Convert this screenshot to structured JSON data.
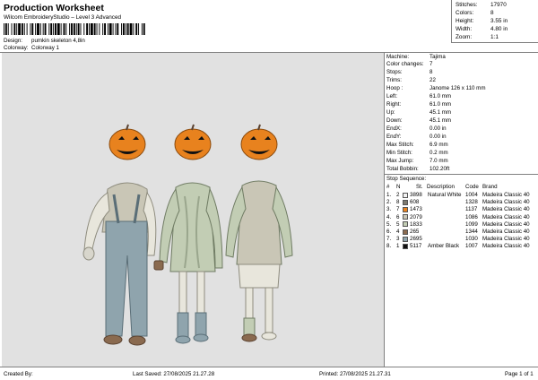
{
  "header": {
    "title": "Production Worksheet",
    "subtitle": "Wilcom EmbroideryStudio – Level 3 Advanced",
    "design_label": "Design:",
    "design_value": "pumkin skeleton 4,8in",
    "colorway_label": "Colorway:",
    "colorway_value": "Colorway 1"
  },
  "summary": [
    {
      "key": "Stitches:",
      "value": "17970"
    },
    {
      "key": "Colors:",
      "value": "8"
    },
    {
      "key": "Height:",
      "value": "3.55 in"
    },
    {
      "key": "Width:",
      "value": "4.80 in"
    },
    {
      "key": "Zoom:",
      "value": "1:1"
    }
  ],
  "machine_info": [
    {
      "key": "Machine:",
      "value": "Tajima"
    },
    {
      "key": "Color changes:",
      "value": "7"
    },
    {
      "key": "Stops:",
      "value": "8"
    },
    {
      "key": "Trims:",
      "value": "22"
    },
    {
      "key": "Hoop :",
      "value": "Janome 126 x 110 mm"
    },
    {
      "key": "Left:",
      "value": "61.0 mm"
    },
    {
      "key": "Right:",
      "value": "61.0 mm"
    },
    {
      "key": "Up:",
      "value": "45.1 mm"
    },
    {
      "key": "Down:",
      "value": "45.1 mm"
    },
    {
      "key": "EndX:",
      "value": "0.00 in"
    },
    {
      "key": "EndY:",
      "value": "0.00 in"
    },
    {
      "key": "Max Stitch:",
      "value": "6.9 mm"
    },
    {
      "key": "Min Stitch:",
      "value": "0.2 mm"
    },
    {
      "key": "Max Jump:",
      "value": "7.0 mm"
    },
    {
      "key": "Total Bobbin:",
      "value": "102.20ft"
    }
  ],
  "stop_sequence": {
    "title": "Stop Sequence:",
    "columns": [
      "#",
      "N",
      "St.",
      "Description",
      "Code",
      "Brand"
    ],
    "rows": [
      {
        "num": "1.",
        "n": "2",
        "color": "#f2f2f2",
        "st": "3898",
        "desc": "Natural White",
        "code": "1004",
        "brand": "Madeira Classic 40"
      },
      {
        "num": "2.",
        "n": "8",
        "color": "#7d7a70",
        "st": "608",
        "desc": "",
        "code": "1328",
        "brand": "Madeira Classic 40"
      },
      {
        "num": "3.",
        "n": "7",
        "color": "#e8821e",
        "st": "1473",
        "desc": "",
        "code": "1137",
        "brand": "Madeira Classic 40"
      },
      {
        "num": "4.",
        "n": "6",
        "color": "#c9c6b6",
        "st": "2079",
        "desc": "",
        "code": "1086",
        "brand": "Madeira Classic 40"
      },
      {
        "num": "5.",
        "n": "5",
        "color": "#c2cdb4",
        "st": "1833",
        "desc": "",
        "code": "1099",
        "brand": "Madeira Classic 40"
      },
      {
        "num": "6.",
        "n": "4",
        "color": "#8a6a4f",
        "st": "265",
        "desc": "",
        "code": "1344",
        "brand": "Madeira Classic 40"
      },
      {
        "num": "7.",
        "n": "3",
        "color": "#8fa4ad",
        "st": "2695",
        "desc": "",
        "code": "1030",
        "brand": "Madeira Classic 40"
      },
      {
        "num": "8.",
        "n": "1",
        "color": "#111111",
        "st": "5117",
        "desc": "Amber Black",
        "code": "1007",
        "brand": "Madeira Classic 40"
      }
    ]
  },
  "footer": {
    "created_by": "Created By:",
    "last_saved": "Last Saved: 27/08/2025 21.27.28",
    "printed": "Printed: 27/08/2025 21.27.31",
    "page": "Page 1 of 1"
  },
  "colors": {
    "canvas_bg": "#e1e1e1",
    "pumpkin": "#e8821e",
    "overalls": "#8fa4ad",
    "sweater": "#c2cdb4",
    "hoodie": "#c9c6b6"
  }
}
